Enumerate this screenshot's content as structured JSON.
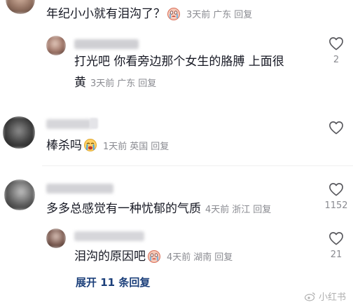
{
  "comments": [
    {
      "text": "年纪小小就有泪沟了？",
      "emoji": "crying-face-emoji",
      "time": "3天前",
      "location": "广东",
      "reply": "回复"
    },
    {
      "text_line1": "打光吧 你看旁边那个女生的胳膊 上面很",
      "text_line2": "黄",
      "time": "3天前",
      "location": "广东",
      "reply": "回复",
      "likes": "2"
    },
    {
      "text": "棒杀吗",
      "emoji": "crying-face-emoji",
      "time": "1天前",
      "location": "英国",
      "reply": "回复"
    },
    {
      "text": "多多总感觉有一种忧郁的气质",
      "time": "4天前",
      "location": "浙江",
      "reply": "回复",
      "likes": "1152"
    },
    {
      "text": "泪沟的原因吧",
      "emoji": "crying-face-emoji",
      "time": "4天前",
      "location": "湖南",
      "reply": "回复",
      "likes": "21"
    }
  ],
  "expand_label": "展开 11 条回复",
  "watermark": "小红书",
  "colors": {
    "text": "#161823",
    "meta": "#8a8b91",
    "link": "#1b3f7a"
  }
}
